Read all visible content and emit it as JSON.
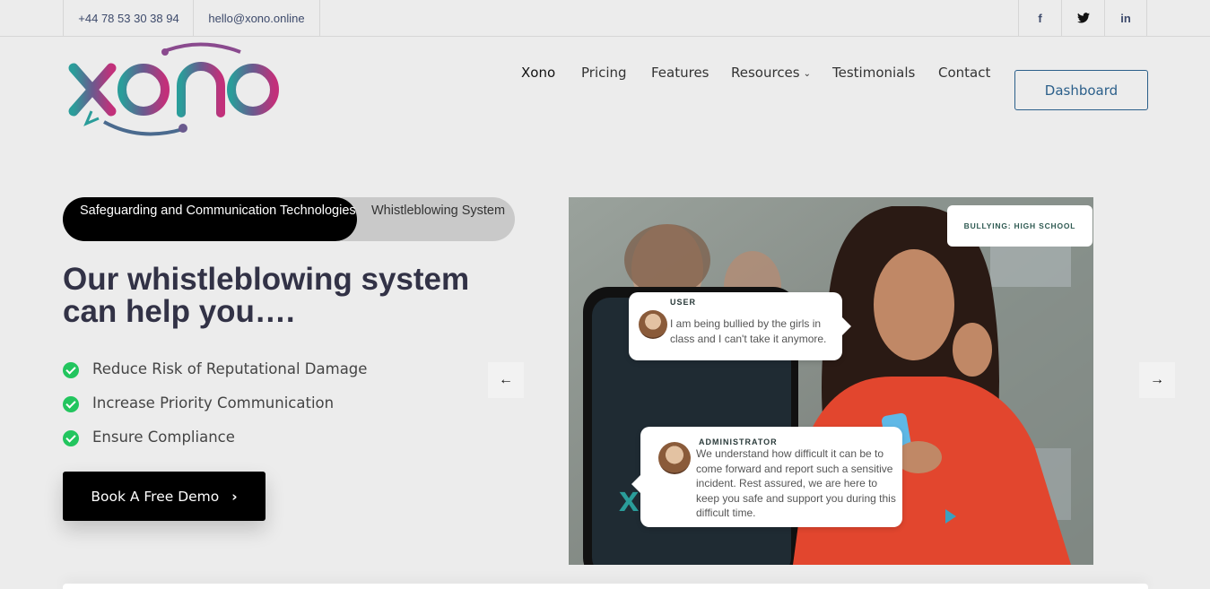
{
  "topbar": {
    "phone": "+44 78 53 30 38 94",
    "email": "hello@xono.online",
    "social": [
      {
        "icon": "facebook-icon",
        "glyph": "f"
      },
      {
        "icon": "twitter-icon",
        "glyph": "🐦"
      },
      {
        "icon": "linkedin-icon",
        "glyph": "in"
      }
    ]
  },
  "logo": {
    "text": "xono",
    "colors": {
      "start": "#2a9d9a",
      "end": "#c2307a"
    }
  },
  "nav": {
    "items": [
      "Xono",
      "Pricing",
      "Features",
      "Resources",
      "Testimonials",
      "Contact"
    ],
    "dashboard": "Dashboard"
  },
  "hero": {
    "tabs": [
      "Safeguarding and Communication Technologies",
      "Whistleblowing System"
    ],
    "active_tab": 0,
    "heading": "Our whistleblowing system can help you….",
    "bullets": [
      "Reduce Risk of Reputational Damage",
      "Increase Priority Communication",
      "Ensure Compliance"
    ],
    "cta": "Book A Free Demo"
  },
  "slide": {
    "badge": "BULLYING: HIGH SCHOOL",
    "user_role": "USER",
    "user_message": "I am being bullied by the girls in class and I can't take it anymore.",
    "admin_role": "ADMINISTRATOR",
    "admin_message": "We understand how difficult it can be to come forward and report such a sensitive incident. Rest assured, we are here to keep you safe and support you during this difficult time."
  },
  "colors": {
    "accent": "#22c55e",
    "brand_blue": "#2b5f8a",
    "dark": "#000000"
  }
}
